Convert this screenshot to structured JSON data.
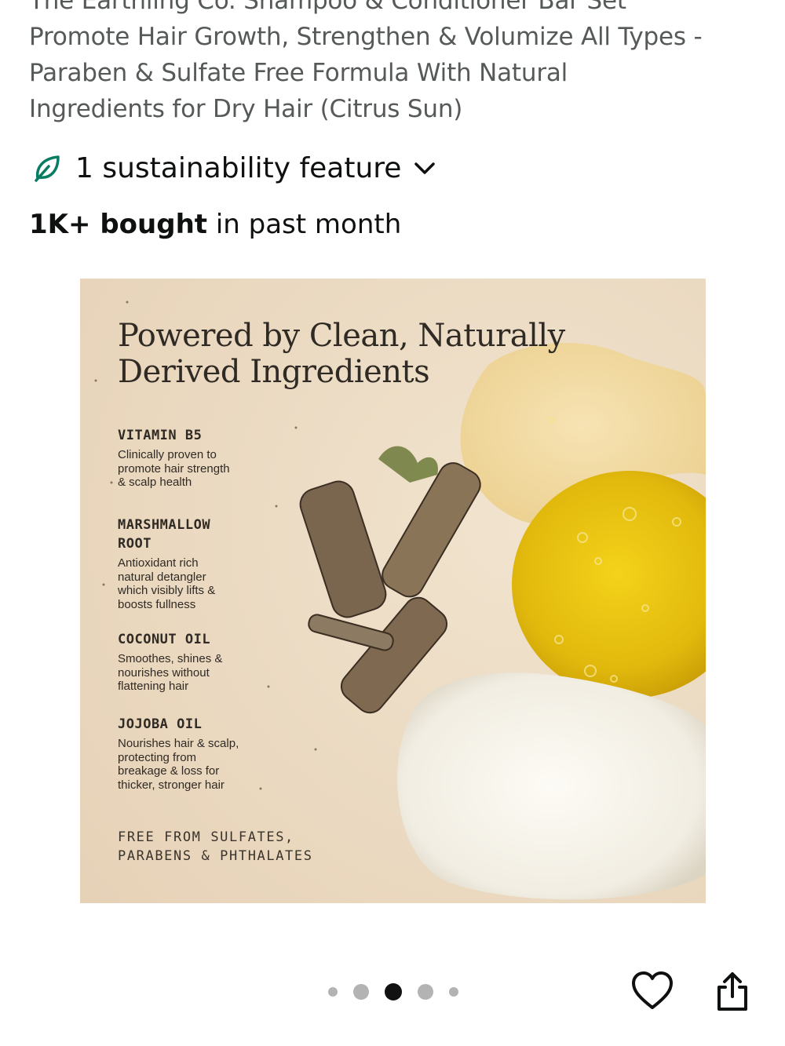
{
  "product": {
    "title_lines": [
      "The Earthling Co. Shampoo & Conditioner Bar Set",
      "Promote Hair Growth, Strengthen & Volumize All Types -",
      "Paraben & Sulfate Free Formula With Natural",
      "Ingredients for Dry Hair (Citrus Sun)"
    ]
  },
  "sustainability": {
    "label": "1 sustainability feature",
    "icon": "leaf-icon",
    "chevron": "chevron-down-icon",
    "icon_color": "#067d62"
  },
  "bought": {
    "count": "1K+ bought",
    "suffix": " in past month"
  },
  "image": {
    "heading_lines": [
      "Powered by Clean, Naturally",
      "Derived Ingredients"
    ],
    "ingredients": [
      {
        "name_lines": [
          "VITAMIN B5"
        ],
        "desc_lines": [
          "Clinically proven to",
          "promote hair strength",
          "& scalp health"
        ]
      },
      {
        "name_lines": [
          "MARSHMALLOW",
          "ROOT"
        ],
        "desc_lines": [
          "Antioxidant rich",
          "natural detangler",
          "which visibly lifts &",
          "boosts fullness"
        ]
      },
      {
        "name_lines": [
          "COCONUT OIL"
        ],
        "desc_lines": [
          "Smoothes, shines &",
          "nourishes without",
          "flattening hair"
        ]
      },
      {
        "name_lines": [
          "JOJOBA OIL"
        ],
        "desc_lines": [
          "Nourishes hair & scalp,",
          "protecting from",
          "breakage & loss for",
          "thicker, stronger hair"
        ]
      }
    ],
    "free_from_lines": [
      "FREE FROM SULFATES,",
      "PARABENS & PHTHALATES"
    ]
  },
  "carousel": {
    "total": 5,
    "active_index": 2
  },
  "actions": {
    "wishlist_icon": "heart-icon",
    "share_icon": "share-icon"
  },
  "colors": {
    "title_gray": "#565959",
    "text": "#0f1111",
    "dot_inactive": "#b3b3b3",
    "dot_active": "#111111"
  }
}
